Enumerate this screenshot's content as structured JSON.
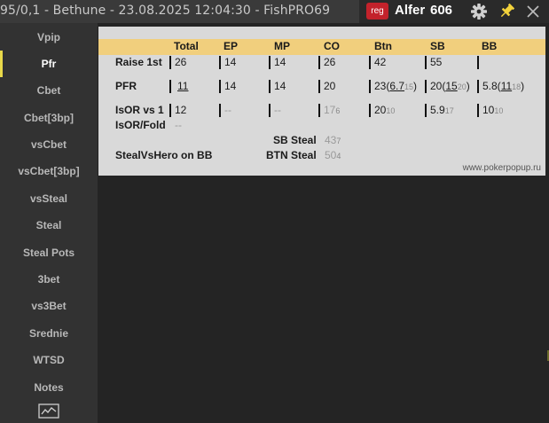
{
  "window": {
    "title": "95/0,1 - Bethune - 23.08.2025 12:04:30 - FishPRO69",
    "player_badge": "reg",
    "player_name": "Alfer",
    "player_hands": "606",
    "icons": [
      "gear-icon",
      "pin-icon",
      "close-icon"
    ]
  },
  "sidebar": {
    "items": [
      "Vpip",
      "Pfr",
      "Cbet",
      "Cbet[3bp]",
      "vsCbet",
      "vsCbet[3bp]",
      "vsSteal",
      "Steal",
      "Steal Pots",
      "3bet",
      "vs3Bet",
      "Srednie",
      "WTSD",
      "Notes"
    ],
    "active": "Pfr",
    "bottom_icon": "chart-icon"
  },
  "table": {
    "headers": [
      "Total",
      "EP",
      "MP",
      "CO",
      "Btn",
      "SB",
      "BB"
    ],
    "raise_first": {
      "label": "Raise 1st",
      "total": "26",
      "ep": "14",
      "mp": "14",
      "co": "26",
      "btn": "42",
      "sb": "55",
      "bb": ""
    },
    "pfr": {
      "label": "PFR",
      "total": "11",
      "ep": "14",
      "mp": "14",
      "co": "20",
      "btn": {
        "main": "23(",
        "link": "6.7",
        "sub": "15",
        "close": ")"
      },
      "sb": {
        "main": "20(",
        "link": "15",
        "sub": "20",
        "close": ")"
      },
      "bb": {
        "main": "5.8(",
        "link": "11",
        "sub": "18",
        "close": ")"
      }
    },
    "isor_vs1": {
      "label": "IsOR vs 1",
      "total": "12",
      "ep": "--",
      "mp": "--",
      "co": {
        "main": "17",
        "sub": "6"
      },
      "btn": {
        "main": "20",
        "sub": "10"
      },
      "sb": {
        "main": "5.9",
        "sub": "17"
      },
      "bb": {
        "main": "10",
        "sub": "10"
      }
    },
    "isor_fold": {
      "label": "IsOR/Fold",
      "value": "--"
    },
    "sb_steal": {
      "label": "SB Steal",
      "main": "43",
      "sub": "7"
    },
    "steal_vs_hero": {
      "label": "StealVsHero on BB"
    },
    "btn_steal": {
      "label": "BTN Steal",
      "main": "50",
      "sub": "4"
    },
    "website": "www.pokerpopup.ru"
  }
}
